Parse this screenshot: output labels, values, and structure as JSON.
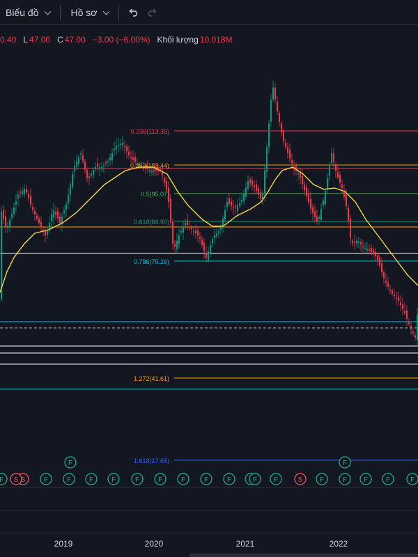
{
  "toolbar": {
    "chart_menu": "Biểu đồ",
    "profile_menu": "Hồ sơ"
  },
  "ohlc": {
    "open_partial": "0.40",
    "low_key": "L",
    "low_val": "47.00",
    "close_key": "C",
    "close_val": "47.00",
    "change": "−3.00 (−6.00%)",
    "volume_key": "Khối lượng",
    "volume_val": "10.018M"
  },
  "fib_levels": [
    {
      "label": "0.236(113.35)",
      "color": "#f23645"
    },
    {
      "label": "0.382(103.44)",
      "color": "#ff9800"
    },
    {
      "label": "0.5(95.07)",
      "color": "#4caf50"
    },
    {
      "label": "0.618(86.90)",
      "color": "#089981"
    },
    {
      "label": "0.786(75.26)",
      "color": "#00bcd4"
    },
    {
      "label": "1.272(41.61)",
      "color": "#ff9800"
    },
    {
      "label": "1.618(17.65)",
      "color": "#2962ff"
    }
  ],
  "x_axis": [
    "2019",
    "2020",
    "2021",
    "2022"
  ],
  "events": {
    "financial": "F",
    "split": "S"
  },
  "colors": {
    "up": "#089981",
    "down": "#f23645",
    "ma": "#f5d742",
    "background": "#131722"
  }
}
